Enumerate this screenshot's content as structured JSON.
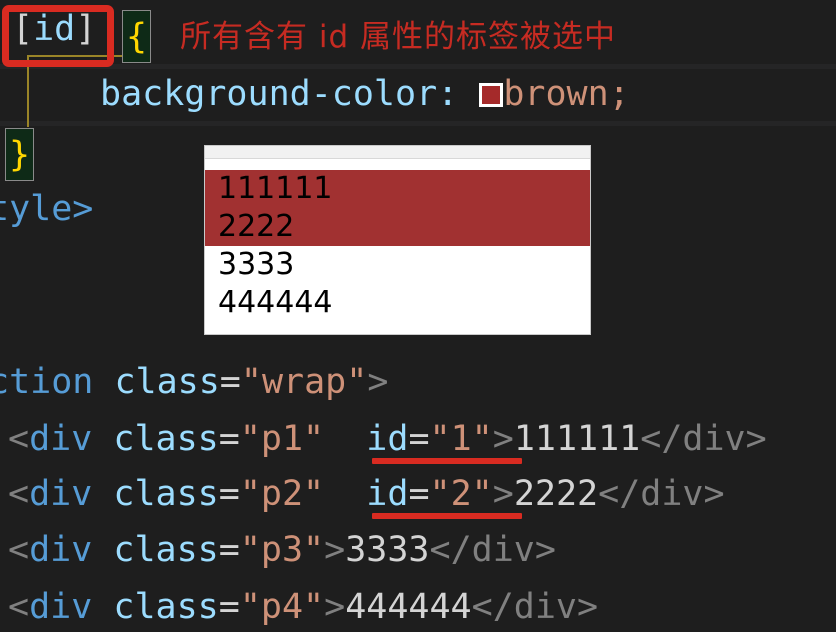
{
  "editor": {
    "theme_background": "#1e1e1e",
    "code_lines": [
      {
        "id": "selector-line",
        "tokens": [
          {
            "text": "[",
            "kind": "bracket"
          },
          {
            "text": "id",
            "kind": "attr"
          },
          {
            "text": "]",
            "kind": "bracket"
          }
        ],
        "plain": "[id]"
      },
      {
        "id": "open-brace-line",
        "plain": "{"
      },
      {
        "id": "declaration-line",
        "property": "background-color:",
        "value": "brown;",
        "swatch_color": "#a52a2a",
        "plain": "background-color: brown;"
      },
      {
        "id": "close-brace-line",
        "plain": "}"
      },
      {
        "id": "style-close-line",
        "plain": "tyle>",
        "full": "</style>"
      },
      {
        "id": "section-open-line",
        "plain": "ction class=\"wrap\">",
        "full": "<section class=\"wrap\">"
      },
      {
        "id": "div-p1-line",
        "plain": "<div class=\"p1\" id=\"1\">111111</div>"
      },
      {
        "id": "div-p2-line",
        "plain": "<div class=\"p2\" id=\"2\">2222</div>"
      },
      {
        "id": "div-p3-line",
        "plain": "<div class=\"p3\">3333</div>"
      },
      {
        "id": "div-p4-line",
        "plain": "<div class=\"p4\">444444</div>"
      }
    ],
    "code": {
      "selector_open_bracket": "[",
      "selector_name": "id",
      "selector_close_bracket": "]",
      "open_brace": "{",
      "close_brace": "}",
      "prop_background_color": "background-color:",
      "value_brown": "brown;",
      "style_close_fragment": "tyle>",
      "section_fragment": "ction ",
      "attr_class": "class",
      "eq": "=",
      "quote": "\"",
      "val_wrap": "wrap",
      "gt": ">",
      "lt": "<",
      "tag_div_open": "div",
      "tag_div_close": "</div>",
      "val_p1": "p1",
      "val_p2": "p2",
      "val_p3": "p3",
      "val_p4": "p4",
      "attr_id": "id",
      "val_id1": "1",
      "val_id2": "2",
      "content_1": "111111",
      "content_2": "2222",
      "content_3": "3333",
      "content_4": "444444"
    }
  },
  "annotations": {
    "note_text": "所有含有 id 属性的标签被选中",
    "note_color": "#c62b22",
    "highlight_box_color": "#d92b21",
    "underline_color": "#d92b21"
  },
  "preview": {
    "rows": [
      {
        "text": "111111",
        "highlighted": true
      },
      {
        "text": "2222",
        "highlighted": true
      },
      {
        "text": "3333",
        "highlighted": false
      },
      {
        "text": "444444",
        "highlighted": false
      }
    ],
    "highlight_background": "#a13131",
    "panel_background": "#ffffff"
  }
}
